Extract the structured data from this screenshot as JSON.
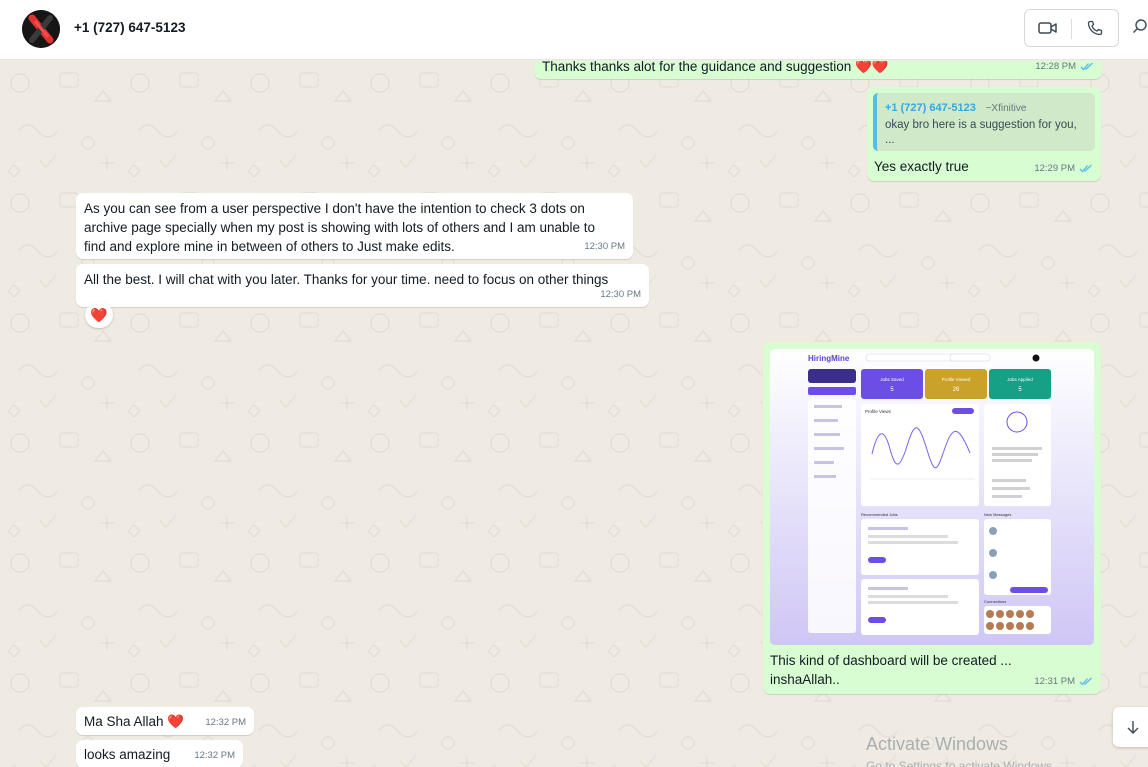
{
  "header": {
    "contact_name": "+1 (727) 647-5123",
    "video_call_icon": "video-call-icon",
    "voice_call_icon": "phone-icon",
    "search_icon": "search-icon"
  },
  "messages": [
    {
      "direction": "out",
      "text": "Thanks thanks alot for the guidance and suggestion ❤️❤️",
      "time": "12:28 PM",
      "status": "read"
    },
    {
      "direction": "out",
      "quote": {
        "author": "+1 (727) 647-5123",
        "author_sub": "~Xfinitive",
        "text": "okay bro here is a suggestion for you, ..."
      },
      "text": "Yes exactly true",
      "time": "12:29 PM",
      "status": "read"
    },
    {
      "direction": "in",
      "text": "As you can see from a user perspective I don't have the intention to check 3 dots on archive page specially when my post is showing with lots of others and I am unable to find and explore mine in between of others to Just make edits.",
      "time": "12:30 PM"
    },
    {
      "direction": "in",
      "text": "All the best. I will chat with you later. Thanks for your time. need to focus on other things",
      "time": "12:30 PM",
      "reaction": "❤️"
    },
    {
      "direction": "out",
      "image": "dashboard-screenshot",
      "text": "This kind of dashboard will be created ... inshaAllah..",
      "time": "12:31 PM",
      "status": "read"
    },
    {
      "direction": "in",
      "text": "Ma Sha Allah ❤️",
      "time": "12:32 PM"
    },
    {
      "direction": "in",
      "text": "looks amazing",
      "time": "12:32 PM"
    }
  ],
  "dashboard_preview": {
    "brand": "HiringMine",
    "stats": [
      {
        "label": "Jobs Saved",
        "value": "5",
        "color": "#6c4de6"
      },
      {
        "label": "Profile Viewed",
        "value": "26",
        "color": "#c9a227"
      },
      {
        "label": "Jobs Applied",
        "value": "5",
        "color": "#16a085"
      }
    ],
    "panels": {
      "profile_views": "Profile Views",
      "recommended_jobs": "Recommended Jobs",
      "new_messages": "New Messages",
      "connections": "Connections"
    }
  },
  "colors": {
    "incoming": "#ffffff",
    "outgoing": "#d9fdd3",
    "chat_background": "#efeae2",
    "read_ticks": "#53bdeb"
  },
  "scroll_down_icon": "arrow-down-icon",
  "watermark": {
    "title": "Activate Windows",
    "subtitle": "Go to Settings to activate Windows."
  }
}
